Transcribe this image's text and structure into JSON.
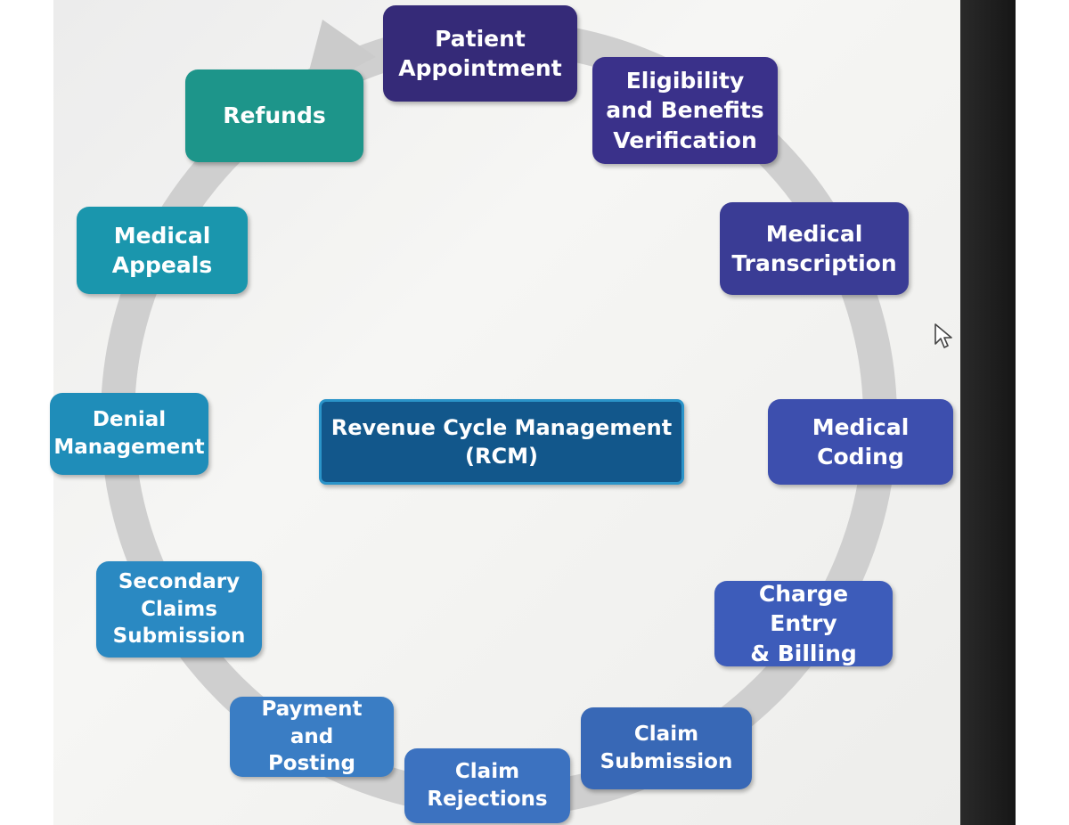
{
  "diagram": {
    "center": {
      "label": "Revenue Cycle Management\n(RCM)",
      "color": "#12578b"
    },
    "steps": [
      {
        "id": "patient-appointment",
        "label": "Patient\nAppointment",
        "color": "#352a78"
      },
      {
        "id": "eligibility",
        "label": "Eligibility\nand Benefits\nVerification",
        "color": "#3a318a"
      },
      {
        "id": "medical-transcription",
        "label": "Medical\nTranscription",
        "color": "#3a3c95"
      },
      {
        "id": "medical-coding",
        "label": "Medical\nCoding",
        "color": "#3d4fae"
      },
      {
        "id": "charge-entry",
        "label": "Charge Entry\n& Billing",
        "color": "#3d5cba"
      },
      {
        "id": "claim-submission",
        "label": "Claim\nSubmission",
        "color": "#3868b6"
      },
      {
        "id": "claim-rejections",
        "label": "Claim\nRejections",
        "color": "#3c72c0"
      },
      {
        "id": "payment-posting",
        "label": "Payment and\nPosting",
        "color": "#3a7dc4"
      },
      {
        "id": "secondary-claims",
        "label": "Secondary\nClaims\nSubmission",
        "color": "#2a89c2"
      },
      {
        "id": "denial-management",
        "label": "Denial\nManagement",
        "color": "#1f8db9"
      },
      {
        "id": "medical-appeals",
        "label": "Medical\nAppeals",
        "color": "#1a96ad"
      },
      {
        "id": "refunds",
        "label": "Refunds",
        "color": "#1d958a"
      }
    ]
  }
}
